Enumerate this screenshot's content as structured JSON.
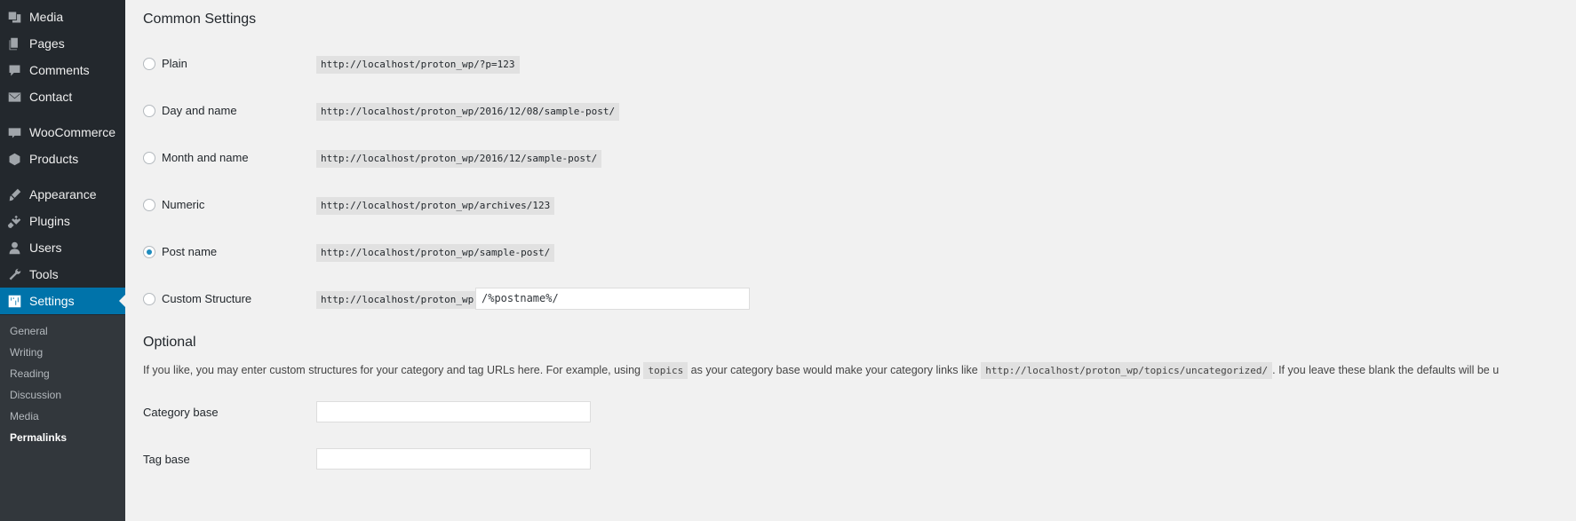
{
  "sidebar": {
    "items": [
      {
        "label": "Media",
        "icon": "media-icon"
      },
      {
        "label": "Pages",
        "icon": "pages-icon"
      },
      {
        "label": "Comments",
        "icon": "comments-icon"
      },
      {
        "label": "Contact",
        "icon": "mail-icon"
      },
      {
        "label": "WooCommerce",
        "icon": "woocommerce-icon"
      },
      {
        "label": "Products",
        "icon": "box-icon"
      },
      {
        "label": "Appearance",
        "icon": "paintbrush-icon"
      },
      {
        "label": "Plugins",
        "icon": "plug-icon"
      },
      {
        "label": "Users",
        "icon": "user-icon"
      },
      {
        "label": "Tools",
        "icon": "wrench-icon"
      },
      {
        "label": "Settings",
        "icon": "settings-icon"
      }
    ],
    "submenu": [
      "General",
      "Writing",
      "Reading",
      "Discussion",
      "Media",
      "Permalinks"
    ],
    "accent_color": "#0073aa"
  },
  "common": {
    "title": "Common Settings",
    "options": [
      {
        "label": "Plain",
        "url": "http://localhost/proton_wp/?p=123",
        "checked": false
      },
      {
        "label": "Day and name",
        "url": "http://localhost/proton_wp/2016/12/08/sample-post/",
        "checked": false
      },
      {
        "label": "Month and name",
        "url": "http://localhost/proton_wp/2016/12/sample-post/",
        "checked": false
      },
      {
        "label": "Numeric",
        "url": "http://localhost/proton_wp/archives/123",
        "checked": false
      },
      {
        "label": "Post name",
        "url": "http://localhost/proton_wp/sample-post/",
        "checked": true
      },
      {
        "label": "Custom Structure",
        "url": "http://localhost/proton_wp",
        "checked": false
      }
    ],
    "custom_value": "/%postname%/"
  },
  "optional": {
    "title": "Optional",
    "desc_1": "If you like, you may enter custom structures for your category and tag URLs here. For example, using ",
    "desc_code_1": "topics",
    "desc_2": " as your category base would make your category links like ",
    "desc_code_2": "http://localhost/proton_wp/topics/uncategorized/",
    "desc_3": ". If you leave these blank the defaults will be u",
    "category_base_label": "Category base",
    "category_base_value": "",
    "tag_base_label": "Tag base",
    "tag_base_value": ""
  }
}
